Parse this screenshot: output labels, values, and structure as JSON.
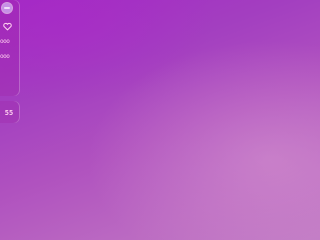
{
  "sidebar": {
    "items": [
      {
        "icon": "avatar-icon"
      },
      {
        "icon": "heart-icon"
      },
      {
        "label": "ooo",
        "icon": "item-glyph"
      },
      {
        "label": "ooo",
        "icon": "item-glyph"
      }
    ]
  },
  "widget": {
    "badge": "55"
  },
  "colors": {
    "background": "#a33fc0",
    "accent": "#ffd0f0"
  }
}
